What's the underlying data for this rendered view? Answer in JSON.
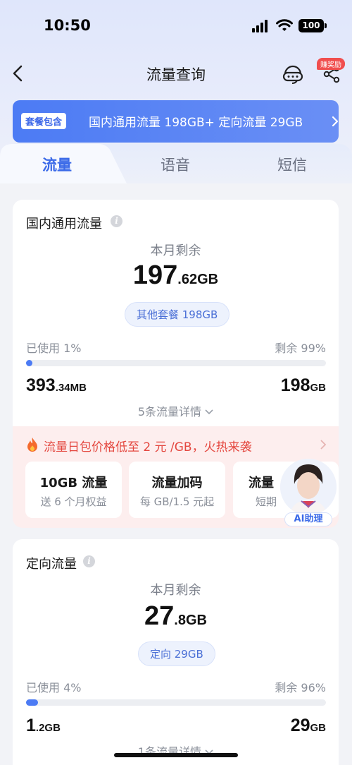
{
  "status_bar": {
    "time": "10:50",
    "battery": "100"
  },
  "nav": {
    "title": "流量查询",
    "reward_badge": "赚奖励"
  },
  "package": {
    "tag": "套餐包含",
    "text": "国内通用流量 198GB+ 定向流量 29GB"
  },
  "tabs": [
    "流量",
    "语音",
    "短信"
  ],
  "general": {
    "title": "国内通用流量",
    "remain_label": "本月剩余",
    "remain_int": "197",
    "remain_dec": ".62GB",
    "pill": "其他套餐 198GB",
    "used_label": "已使用 1%",
    "left_label": "剩余 99%",
    "used_fraction": 0.01,
    "used_int": "393",
    "used_dec": ".34MB",
    "total_int": "198",
    "total_unit": "GB",
    "details": "5条流量详情"
  },
  "promo": {
    "text": "流量日包价格低至 2 元 /GB，火热来袭",
    "offers": [
      {
        "title": "10GB 流量",
        "sub": "送 6 个月权益"
      },
      {
        "title": "流量加码",
        "sub": "每 GB/1.5 元起"
      },
      {
        "title": "流量",
        "sub": "短期"
      }
    ]
  },
  "assistant": {
    "label": "AI助理"
  },
  "directed": {
    "title": "定向流量",
    "remain_label": "本月剩余",
    "remain_int": "27",
    "remain_dec": ".8GB",
    "pill": "定向 29GB",
    "used_label": "已使用 4%",
    "left_label": "剩余 96%",
    "used_fraction": 0.04,
    "used_int": "1",
    "used_dec": ".2GB",
    "total_int": "29",
    "total_unit": "GB",
    "details": "1条流量详情"
  },
  "colors": {
    "accent": "#4c7bf4",
    "promo_red": "#e4473f"
  }
}
